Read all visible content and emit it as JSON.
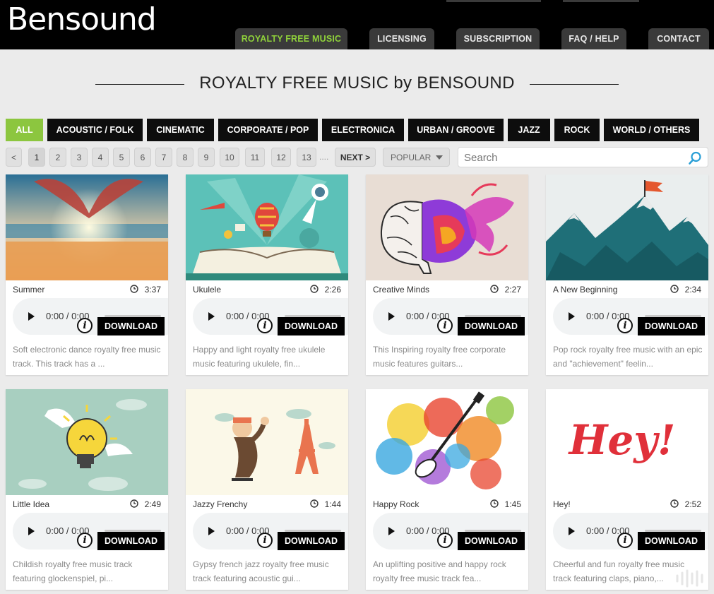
{
  "site": {
    "logo": "Bensound"
  },
  "nav": [
    {
      "label": "ROYALTY FREE MUSIC",
      "active": true
    },
    {
      "label": "LICENSING"
    },
    {
      "label": "SUBSCRIPTION"
    },
    {
      "label": "FAQ / HELP"
    },
    {
      "label": "CONTACT"
    }
  ],
  "page_title": "ROYALTY FREE MUSIC by BENSOUND",
  "genres": [
    "ALL",
    "ACOUSTIC / FOLK",
    "CINEMATIC",
    "CORPORATE / POP",
    "ELECTRONICA",
    "URBAN / GROOVE",
    "JAZZ",
    "ROCK",
    "WORLD / OTHERS"
  ],
  "active_genre": "ALL",
  "pagination": {
    "prev": "<",
    "pages": [
      "1",
      "2",
      "3",
      "4",
      "5",
      "6",
      "7",
      "8",
      "9",
      "10",
      "11",
      "12",
      "13"
    ],
    "current": "1",
    "ellipsis": "....",
    "next": "NEXT >"
  },
  "sort": {
    "selected": "POPULAR"
  },
  "search": {
    "placeholder": "Search",
    "value": ""
  },
  "player": {
    "time": "0:00 / 0:00",
    "download_label": "DOWNLOAD",
    "info_label": "i"
  },
  "tracks": [
    {
      "title": "Summer",
      "duration": "3:37",
      "desc": "Soft electronic dance royalty free music track. This track has a ..."
    },
    {
      "title": "Ukulele",
      "duration": "2:26",
      "desc": "Happy and light royalty free ukulele music featuring ukulele, fin..."
    },
    {
      "title": "Creative Minds",
      "duration": "2:27",
      "desc": "This Inspiring royalty free corporate music features guitars..."
    },
    {
      "title": "A New Beginning",
      "duration": "2:34",
      "desc": "Pop rock royalty free music with an epic and \"achievement\" feelin..."
    },
    {
      "title": "Little Idea",
      "duration": "2:49",
      "desc": "Childish royalty free music track featuring glockenspiel, pi..."
    },
    {
      "title": "Jazzy Frenchy",
      "duration": "1:44",
      "desc": "Gypsy french jazz royalty free music track featuring acoustic gui..."
    },
    {
      "title": "Happy Rock",
      "duration": "1:45",
      "desc": "An uplifting positive and happy rock royalty free music track fea..."
    },
    {
      "title": "Hey!",
      "duration": "2:52",
      "desc": "Cheerful and fun royalty free music track featuring claps, piano,..."
    }
  ],
  "thumb_text": {
    "hey": "Hey!"
  },
  "colors": {
    "accent": "#8cc63f",
    "header": "#000000",
    "tab": "#3a3a3a",
    "background": "#ebebeb"
  },
  "icons": [
    "play-icon",
    "info-icon",
    "clock-icon",
    "search-icon",
    "caret-down-icon",
    "watermark-icon"
  ]
}
